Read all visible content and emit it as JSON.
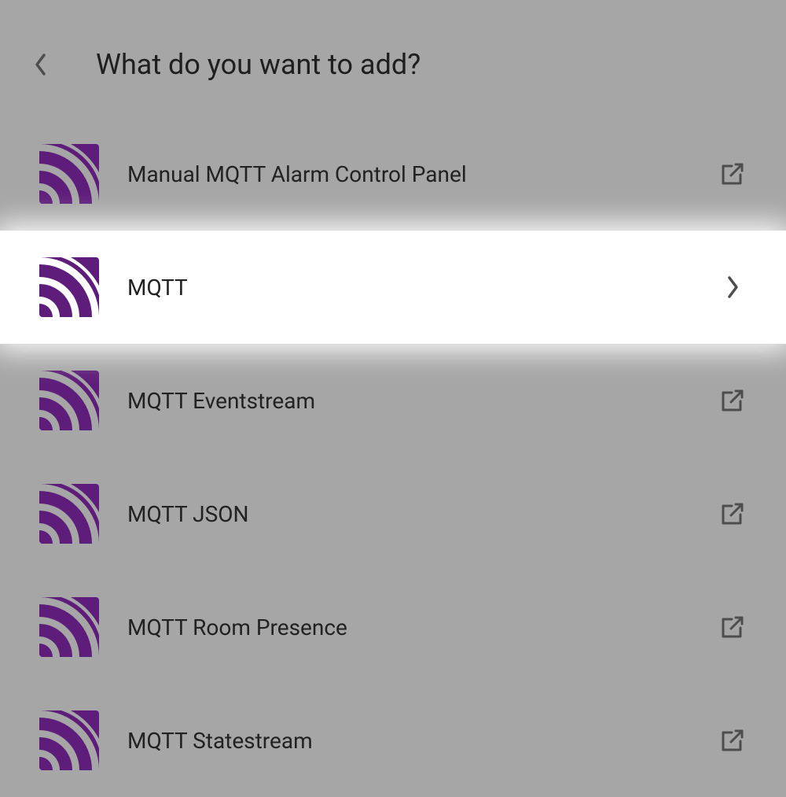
{
  "header": {
    "title": "What do you want to add?"
  },
  "items": [
    {
      "label": "Manual MQTT Alarm Control Panel",
      "action": "external",
      "highlighted": false
    },
    {
      "label": "MQTT",
      "action": "chevron",
      "highlighted": true
    },
    {
      "label": "MQTT Eventstream",
      "action": "external",
      "highlighted": false
    },
    {
      "label": "MQTT JSON",
      "action": "external",
      "highlighted": false
    },
    {
      "label": "MQTT Room Presence",
      "action": "external",
      "highlighted": false
    },
    {
      "label": "MQTT Statestream",
      "action": "external",
      "highlighted": false
    }
  ],
  "colors": {
    "icon_fill": "#5e1d7a",
    "action_stroke": "#4d4d4d",
    "back_stroke": "#4d4d4d"
  }
}
